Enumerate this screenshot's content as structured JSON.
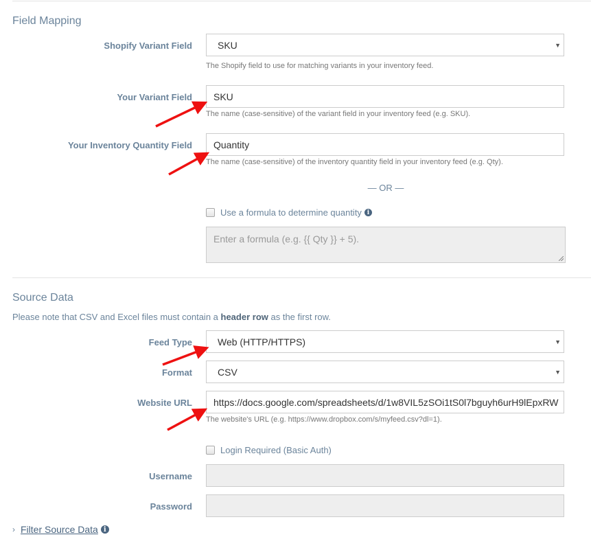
{
  "field_mapping": {
    "title": "Field Mapping",
    "shopify_variant_field": {
      "label": "Shopify Variant Field",
      "value": "SKU",
      "help": "The Shopify field to use for matching variants in your inventory feed."
    },
    "your_variant_field": {
      "label": "Your Variant Field",
      "value": "SKU",
      "help": "The name (case-sensitive) of the variant field in your inventory feed (e.g. SKU)."
    },
    "inventory_quantity_field": {
      "label": "Your Inventory Quantity Field",
      "value": "Quantity",
      "help": "The name (case-sensitive) of the inventory quantity field in your inventory feed (e.g. Qty)."
    },
    "or_divider": "— OR —",
    "formula_checkbox": {
      "label": "Use a formula to determine quantity",
      "checked": false
    },
    "formula_textarea": {
      "value": "",
      "placeholder": "Enter a formula (e.g. {{ Qty }} + 5)."
    }
  },
  "source_data": {
    "title": "Source Data",
    "note_before": "Please note that CSV and Excel files must contain a ",
    "note_bold": "header row",
    "note_after": " as the first row.",
    "feed_type": {
      "label": "Feed Type",
      "value": "Web (HTTP/HTTPS)"
    },
    "format": {
      "label": "Format",
      "value": "CSV"
    },
    "website_url": {
      "label": "Website URL",
      "value": "https://docs.google.com/spreadsheets/d/1w8VIL5zSOi1tS0l7bguyh6urH9lEpxRW",
      "help": "The website's URL (e.g. https://www.dropbox.com/s/myfeed.csv?dl=1)."
    },
    "login_checkbox": {
      "label": "Login Required (Basic Auth)",
      "checked": false
    },
    "username": {
      "label": "Username",
      "value": ""
    },
    "password": {
      "label": "Password",
      "value": ""
    },
    "filter_link": "Filter Source Data"
  },
  "icons": {
    "select_caret": "▼",
    "info": "i",
    "chevron_right": "›"
  },
  "colors": {
    "label": "#6b849b",
    "annotation_arrow": "#ee1111",
    "disabled_bg": "#eeeeee"
  }
}
